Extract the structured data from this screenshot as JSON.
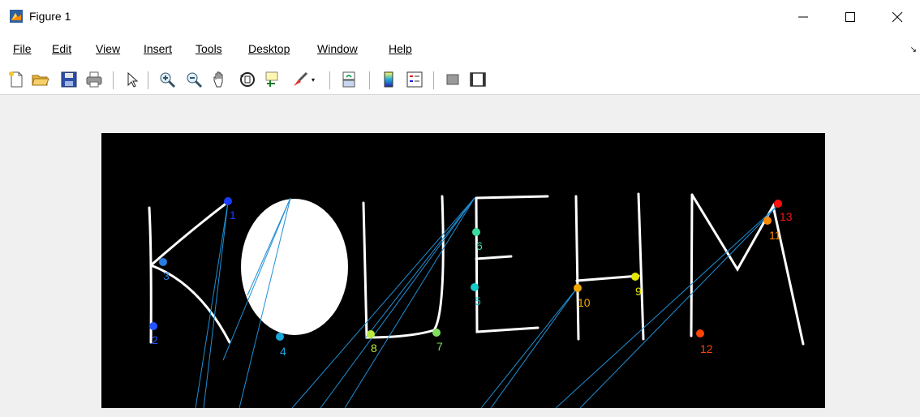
{
  "window": {
    "title": "Figure 1"
  },
  "menu": [
    {
      "label": "File"
    },
    {
      "label": "Edit"
    },
    {
      "label": "View"
    },
    {
      "label": "Insert"
    },
    {
      "label": "Tools"
    },
    {
      "label": "Desktop"
    },
    {
      "label": "Window"
    },
    {
      "label": "Help"
    }
  ],
  "toolbar": {
    "icons": [
      "new-figure-icon",
      "open-file-icon",
      "save-icon",
      "print-icon",
      "edit-plot-icon",
      "zoom-in-icon",
      "zoom-out-icon",
      "pan-icon",
      "rotate-3d-icon",
      "data-cursor-icon",
      "brush-icon",
      "link-plot-icon",
      "insert-colorbar-icon",
      "insert-legend-icon",
      "hide-plot-tools-icon",
      "show-plot-tools-icon"
    ]
  },
  "colors": {
    "axes_bg": "#000000",
    "stroke": "#ffffff",
    "line": "#1f8fd6"
  },
  "plot": {
    "labels": [
      {
        "text": "1",
        "color": "#1a3cff"
      },
      {
        "text": "2",
        "color": "#2255ff"
      },
      {
        "text": "3",
        "color": "#2a7be0"
      },
      {
        "text": "4",
        "color": "#1aa6d8"
      },
      {
        "text": "5",
        "color": "#17c9c9"
      },
      {
        "text": "6",
        "color": "#3bdba0"
      },
      {
        "text": "7",
        "color": "#7fe060"
      },
      {
        "text": "8",
        "color": "#b8ea3c"
      },
      {
        "text": "9",
        "color": "#e6e600"
      },
      {
        "text": "10",
        "color": "#f0a500"
      },
      {
        "text": "11",
        "color": "#ff8c00"
      },
      {
        "text": "12",
        "color": "#ff4400"
      },
      {
        "text": "13",
        "color": "#ff1010"
      }
    ]
  }
}
